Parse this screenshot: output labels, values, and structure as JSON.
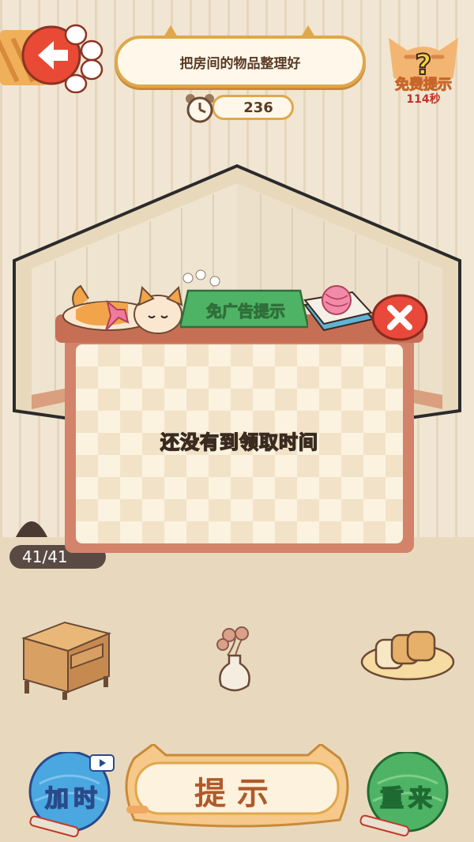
{
  "header": {
    "task_text": "把房间的物品整理好",
    "timer_value": "236",
    "free_hint_label": "免费提示",
    "free_hint_countdown": "114秒"
  },
  "modal": {
    "ad_free_label": "免广告提示",
    "message": "还没有到领取时间"
  },
  "progress": {
    "text": "41/41"
  },
  "controls": {
    "add_time_label": "加时",
    "hint_label": "提示",
    "restart_label": "重来"
  },
  "colors": {
    "background": "#efe3cf",
    "modal_frame": "#d2836a",
    "ad_green": "#4fb365",
    "close_red": "#e8493a",
    "banner_border": "#e0a74b"
  }
}
